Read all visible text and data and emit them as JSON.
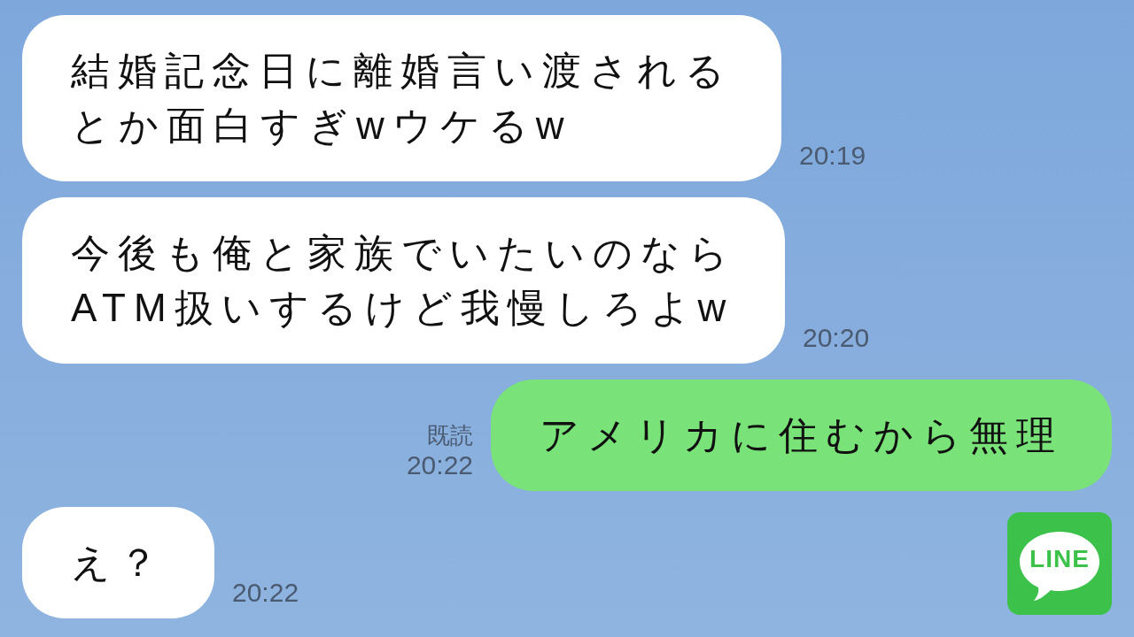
{
  "messages": [
    {
      "kind": "incoming",
      "lines": [
        "結婚記念日に離婚言い渡される",
        "とか面白すぎwウケるw"
      ],
      "time": "20:19"
    },
    {
      "kind": "incoming",
      "lines": [
        "今後も俺と家族でいたいのなら",
        "ATM扱いするけど我慢しろよw"
      ],
      "time": "20:20"
    },
    {
      "kind": "outgoing",
      "lines": [
        "アメリカに住むから無理"
      ],
      "read": "既読",
      "time": "20:22"
    },
    {
      "kind": "incoming",
      "lines": [
        "え？"
      ],
      "time": "20:22"
    }
  ],
  "logo": {
    "text": "LINE"
  }
}
